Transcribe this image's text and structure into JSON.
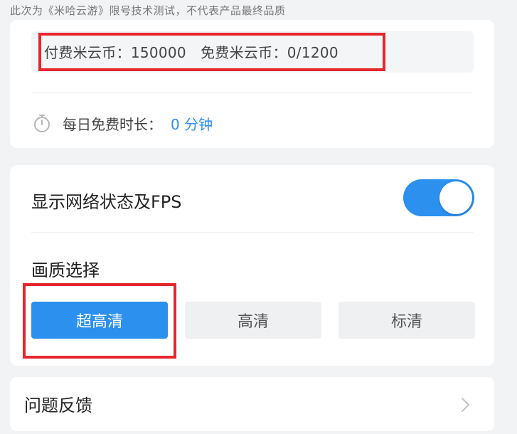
{
  "disclaimer": "此次为《米哈云游》限号技术测试，不代表产品最终品质",
  "coins": {
    "paid_label": "付费米云币：",
    "paid_value": "150000",
    "free_label": "免费米云币：",
    "free_value": "0/1200"
  },
  "daily_free": {
    "label": "每日免费时长：",
    "value": "0 分钟",
    "icon": "stopwatch-icon"
  },
  "settings": {
    "fps_label": "显示网络状态及FPS",
    "fps_enabled": true,
    "quality_title": "画质选择",
    "quality_options": [
      "超高清",
      "高清",
      "标清"
    ],
    "quality_selected": "超高清"
  },
  "feedback": {
    "label": "问题反馈",
    "icon": "chevron-right-icon"
  },
  "colors": {
    "accent": "#2b90ee",
    "highlight": "#e5262d"
  }
}
